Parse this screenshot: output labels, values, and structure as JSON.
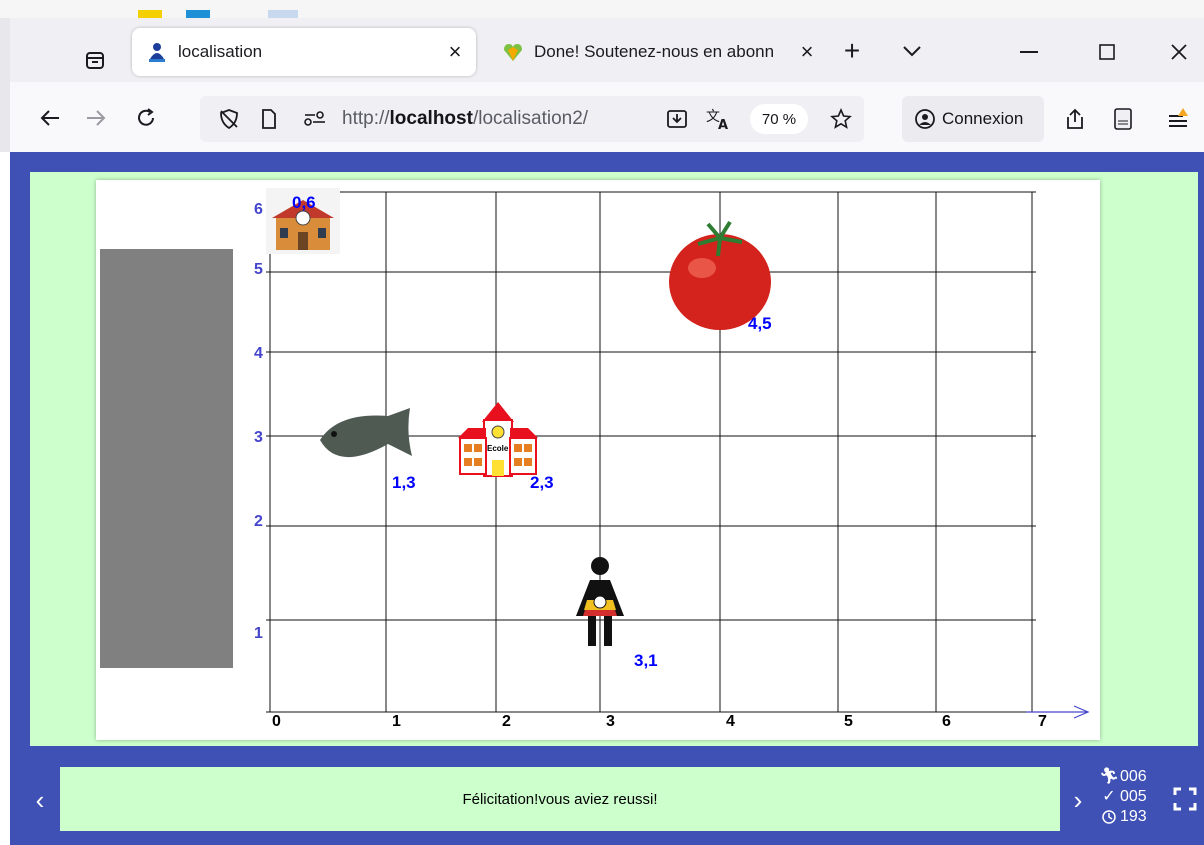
{
  "browser": {
    "tabs": [
      {
        "title": "localisation",
        "active": true
      },
      {
        "title": "Done! Soutenez-nous en abonn",
        "active": false
      }
    ],
    "url": {
      "prefix": "http://",
      "host": "localhost",
      "path": "/localisation2/"
    },
    "zoom": "70 %",
    "account_label": "Connexion"
  },
  "game": {
    "y_axis_ticks": [
      "6",
      "5",
      "4",
      "3",
      "2",
      "1"
    ],
    "x_axis_ticks": [
      "0",
      "1",
      "2",
      "3",
      "4",
      "5",
      "6",
      "7"
    ],
    "items": [
      {
        "name": "old-school",
        "label": "0,6",
        "x": 0,
        "y": 6
      },
      {
        "name": "tomato",
        "label": "4,5",
        "x": 4,
        "y": 5
      },
      {
        "name": "fish",
        "label": "1,3",
        "x": 1,
        "y": 3
      },
      {
        "name": "school",
        "label": "2,3",
        "x": 2,
        "y": 3
      },
      {
        "name": "person",
        "label": "3,1",
        "x": 3,
        "y": 1
      }
    ],
    "school_sign": "Ecole",
    "message": "Félicitation!vous aviez reussi!",
    "stats": {
      "moves": "006",
      "correct": "005",
      "time": "193"
    }
  },
  "colors": {
    "page_bg": "#3f51b5",
    "panel_bg": "#ccffcc",
    "label_blue": "#0000ff",
    "axis_gray": "#4444cc"
  }
}
